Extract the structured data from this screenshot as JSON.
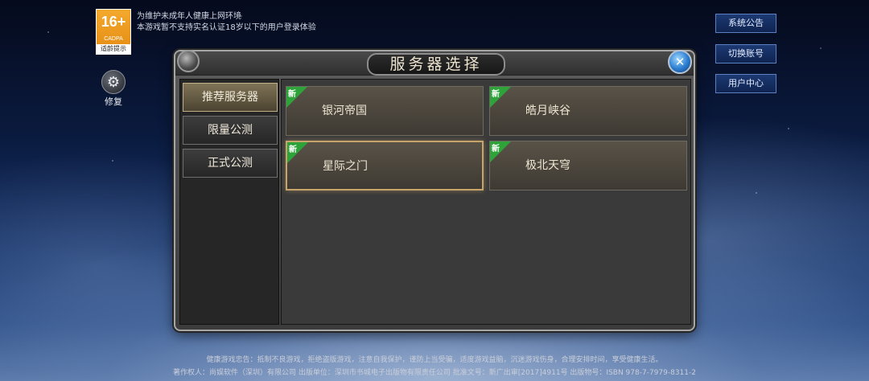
{
  "age_rating": {
    "number": "16+",
    "org": "CADPA",
    "tip": "适龄提示"
  },
  "notice": {
    "line1": "为维护未成年人健康上网环境",
    "line2": "本游戏暂不支持实名认证18岁以下的用户登录体验"
  },
  "repair": {
    "label": "修复",
    "icon": "wrench-gear-icon"
  },
  "side_menu": {
    "announcement": "系统公告",
    "switch_account": "切换账号",
    "user_center": "用户中心"
  },
  "dialog": {
    "title": "服务器选择",
    "close_glyph": "✕",
    "tabs": [
      {
        "label": "推荐服务器",
        "active": true
      },
      {
        "label": "限量公测",
        "active": false
      },
      {
        "label": "正式公测",
        "active": false
      }
    ],
    "servers": [
      {
        "name": "银河帝国",
        "tag": "新",
        "selected": false
      },
      {
        "name": "皓月峡谷",
        "tag": "新",
        "selected": false
      },
      {
        "name": "星际之门",
        "tag": "新",
        "selected": true
      },
      {
        "name": "极北天穹",
        "tag": "新",
        "selected": false
      }
    ]
  },
  "footer": {
    "line1": "健康游戏忠告：抵制不良游戏，拒绝盗版游戏，注意自我保护，谨防上当受骗，适度游戏益脑，沉迷游戏伤身，合理安排时间，享受健康生活。",
    "line2": "著作权人：尚娱软件（深圳）有限公司 出版单位：深圳市书城电子出版物有限责任公司 批准文号：新广出审[2017]4911号 出版物号：ISBN 978-7-7979-8311-2"
  },
  "colors": {
    "accent_blue": "#1c3a73",
    "new_tag_green": "#2ea33a",
    "selected_gold": "#c7a56a"
  }
}
